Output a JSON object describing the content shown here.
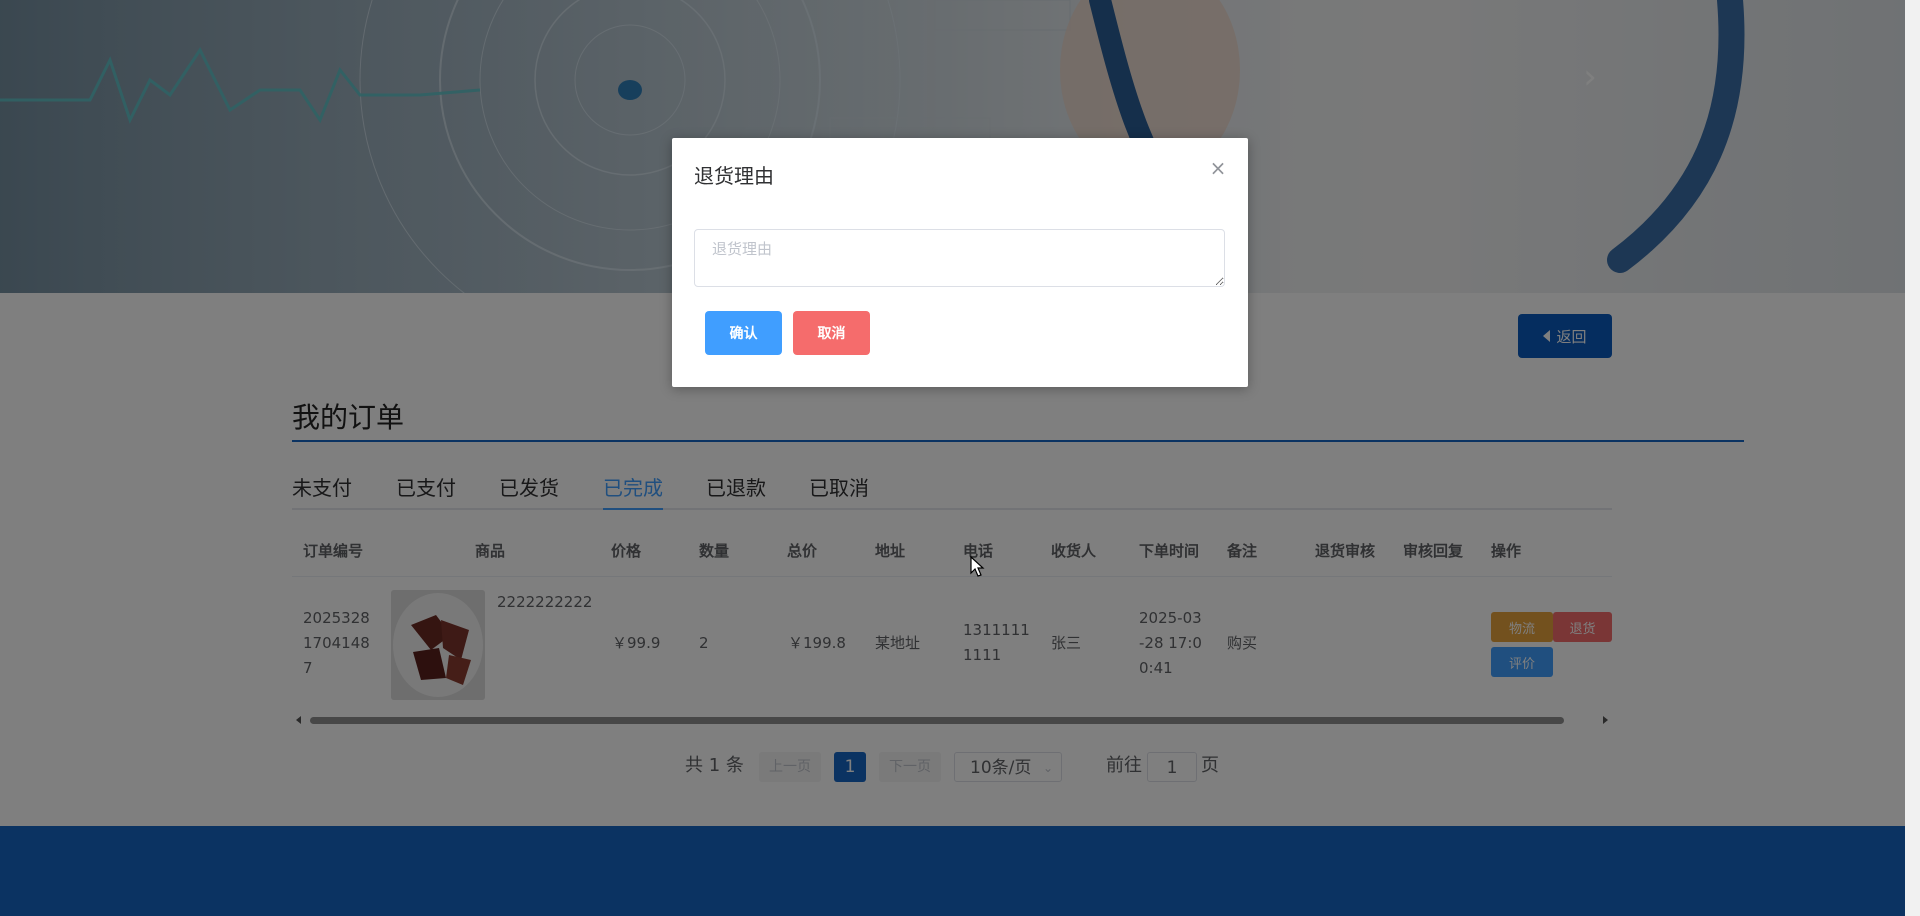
{
  "banner": {
    "next_arrow": "›"
  },
  "header": {
    "back_label": "返回"
  },
  "orders": {
    "title": "我的订单",
    "tabs": [
      {
        "label": "未支付"
      },
      {
        "label": "已支付"
      },
      {
        "label": "已发货"
      },
      {
        "label": "已完成",
        "active": true
      },
      {
        "label": "已退款"
      },
      {
        "label": "已取消"
      }
    ],
    "columns": [
      "订单编号",
      "商品",
      "价格",
      "数量",
      "总价",
      "地址",
      "电话",
      "收货人",
      "下单时间",
      "备注",
      "退货审核",
      "审核回复",
      "操作"
    ],
    "row": {
      "order_no": "2025328 1704148 7",
      "product_name": "2222222222",
      "price": "￥99.9",
      "quantity": "2",
      "total": "￥199.8",
      "address": "某地址",
      "phone": "1311111 1111",
      "receiver": "张三",
      "order_time": "2025-03 -28 17:0 0:41",
      "note": "购买",
      "return_review": "",
      "review_reply": "",
      "actions": {
        "logistics": "物流",
        "return": "退货",
        "review": "评价"
      }
    }
  },
  "pagination": {
    "total_text": "共 1 条",
    "prev": "上一页",
    "current_page": "1",
    "next": "下一页",
    "page_size": "10条/页",
    "goto_prefix": "前往",
    "goto_value": "1",
    "goto_suffix": "页"
  },
  "modal": {
    "title": "退货理由",
    "close": "×",
    "reason_placeholder": "退货理由",
    "confirm": "确认",
    "cancel": "取消"
  },
  "colors": {
    "primary": "#409eff",
    "brand_blue": "#1766c4",
    "danger": "#f56c6c",
    "warning": "#e6a23c"
  },
  "icons": [
    "chevron-right-icon",
    "caret-left-icon",
    "close-icon",
    "chevron-down-icon",
    "mouse-cursor-icon"
  ]
}
